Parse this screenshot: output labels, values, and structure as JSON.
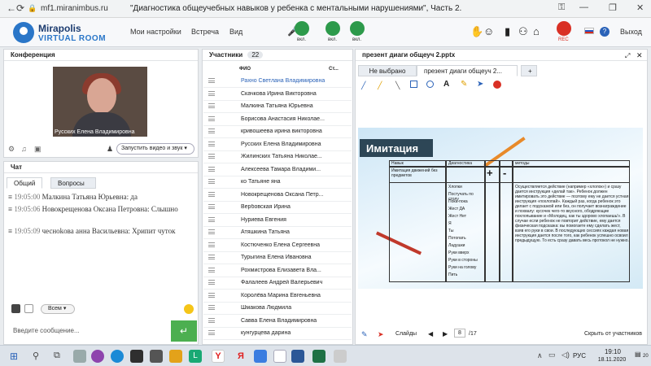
{
  "browser": {
    "url": "mf1.miranimbus.ru",
    "page_title": "\"Диагностика общеучебных навыков у ребенка с ментальными нарушениями\", Часть 2."
  },
  "app": {
    "logo_line1": "Mirapolis",
    "logo_line2": "VIRTUAL ROOM",
    "menu": [
      "Мои настройки",
      "Встреча",
      "Вид"
    ],
    "mic_label": "вкл.",
    "cam_label": "вкл.",
    "screen_label": "вкл.",
    "rec_label": "REC",
    "exit_label": "Выход"
  },
  "conference": {
    "title": "Конференция",
    "video_name": "Русских Елена Владимировна",
    "start_btn": "Запустить видео и звук"
  },
  "chat": {
    "title": "Чат",
    "tabs": [
      "Общий",
      "Вопросы"
    ],
    "messages": [
      {
        "time": "19:05:00",
        "author": "Малкина Татьяна Юрьевна:",
        "text": "да"
      },
      {
        "time": "19:05:06",
        "author": "Новокрещенова Оксана Петровна:",
        "text": "Слышно"
      },
      {
        "time": "19:05:09",
        "author": "чесноkова анна Васильевна:",
        "text": "Хрипит чуток"
      }
    ],
    "recipient": "Всем",
    "input_placeholder": "Введите сообщение..."
  },
  "participants": {
    "title": "Участники",
    "count": "22",
    "col_name": "ФИО",
    "col_status": "Ст...",
    "list": [
      "Рахно Светлана Владимировна",
      "Скачкова Ирина Викторовна",
      "Малкина Татьяна Юрьевна",
      "Борисова Анастасия Николае...",
      "кривошеева ирина викторовна",
      "Русских Елена Владимировна",
      "Жилинских Татьяна Николае...",
      "Алексеева Тамара Владими...",
      "ко Татьяне яна",
      "Новокрещенова Оксана Петр...",
      "Вербовская Ирина",
      "Нуриева Евгения",
      "Атяшкина Татьяна",
      "Костюченко Елена Сергеевна",
      "Турыгина Елена Ивановна",
      "Рохмистрова Елизавета Вла...",
      "Фалалеев Андрей Валерьевич",
      "Королёва Марина Евгеньевна",
      "Шмакова Людмила",
      "Савва Елена Владимировна",
      "кунгурцева дарина"
    ]
  },
  "presentation": {
    "title": "презент диаги общеуч 2.pptx",
    "tabs": [
      "Не выбрано",
      "презент диаги общеуч 2..."
    ],
    "add_tab": "+",
    "slide_heading": "Имитация",
    "table_headers": [
      "Навык",
      "Диагностика",
      "методы"
    ],
    "row_label": "Имитация движений без предметов",
    "plus": "+",
    "minus": "-",
    "diag_lines": [
      "Хлопки",
      "Постучать по столу",
      "Пока-пока",
      "Жест ДА",
      "Жест Нет",
      "Я",
      "Ты",
      "Потопать",
      "Ладушки",
      "Руки вверх",
      "Руки в стороны",
      "Руки на голову",
      "Пить"
    ],
    "methods_text": "Осуществляется действие (например «хлопок») и сразу дается инструкция «делай так». Ребенок должен имитировать это действие — поэтому ему не дается устная инструкция «похлопай». Каждый раз, когда ребенок это делает с подсказкой или без, он получает вознаграждение и похвалу: кусочек чего-то вкусного, ободряющие похлопывание и «Молодец, как ты здорово хлопаешь!». В случае если ребенок не повторит действие, ему дается физическая подсказка: вы помогаете ему сделать жест, взяв его руки в свои. В последующих сессиях каждая новая инструкция дается после того, как ребенок успешно освоил предыдущую. То есть сразу давать весь протокол не нужно.",
    "footer_slides": "Слайды",
    "page_current": "8",
    "page_total": "/17",
    "hide_label": "Скрыть от участников"
  },
  "taskbar": {
    "lang": "РУС",
    "time": "19:10",
    "date": "18.11.2020",
    "notif": "20"
  }
}
